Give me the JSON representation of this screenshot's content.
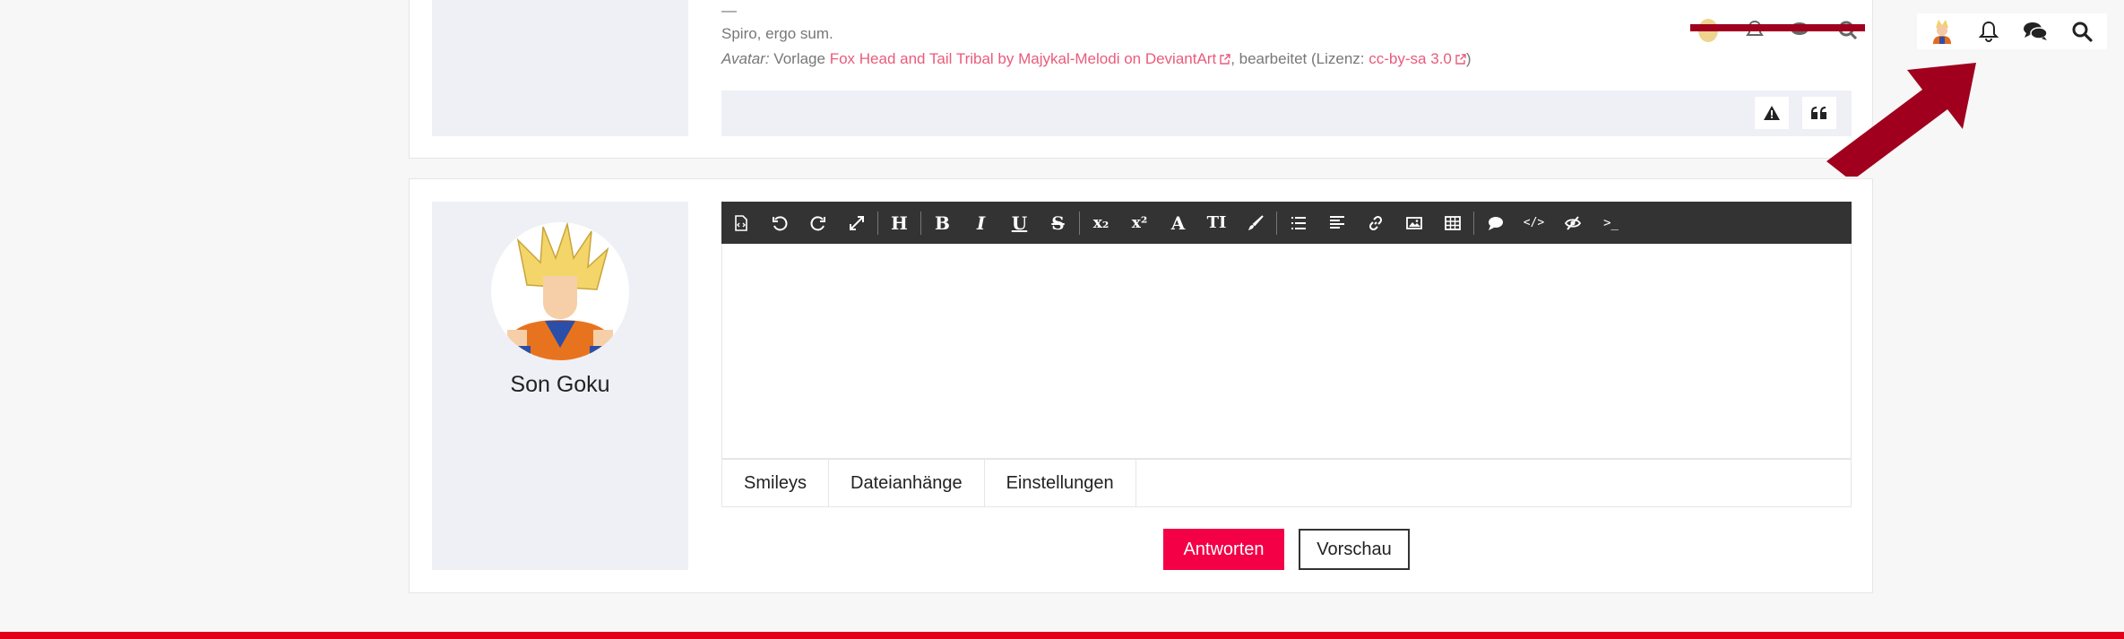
{
  "post": {
    "signature_dash": "—",
    "signature_line": "Spiro, ergo sum.",
    "avatar_label": "Avatar:",
    "avatar_text1": "Vorlage",
    "avatar_link": "Fox Head and Tail Tribal by Majykal-Melodi on DeviantArt",
    "avatar_text2": ", bearbeitet (Lizenz:",
    "license_link": "cc-by-sa 3.0",
    "avatar_text3": ")"
  },
  "reply": {
    "username": "Son Goku",
    "tabs": [
      {
        "label": "Smileys"
      },
      {
        "label": "Dateianhänge"
      },
      {
        "label": "Einstellungen"
      }
    ],
    "submit_label": "Antworten",
    "preview_label": "Vorschau"
  },
  "toolbar": {
    "heading": "H",
    "bold": "B",
    "italic": "I",
    "underline": "U",
    "strike": "S",
    "subscript": "x₂",
    "superscript": "x²",
    "font": "A",
    "size": "TI",
    "code": "</>",
    "terminal": ">_"
  },
  "icons": {
    "report": "warning-icon",
    "quote": "quote-icon",
    "notifications": "bell-icon",
    "messages": "chat-icon",
    "search": "search-icon"
  },
  "colors": {
    "accent": "#f30046",
    "link": "#ea5b7b",
    "toolbar": "#333333",
    "arrow": "#a0001e"
  }
}
